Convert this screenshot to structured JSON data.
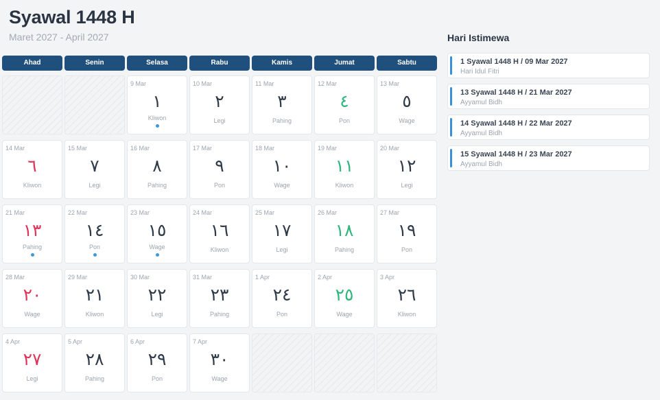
{
  "header": {
    "title": "Syawal 1448 H",
    "subtitle": "Maret 2027 - April 2027"
  },
  "weekdays": [
    "Ahad",
    "Senin",
    "Selasa",
    "Rabu",
    "Kamis",
    "Jumat",
    "Sabtu"
  ],
  "calendar": {
    "leading_empty": 2,
    "trailing_empty": 3,
    "days": [
      {
        "greg": "9 Mar",
        "hijri": "١",
        "pasaran": "Kliwon",
        "dot": true
      },
      {
        "greg": "10 Mar",
        "hijri": "٢",
        "pasaran": "Legi",
        "dot": false
      },
      {
        "greg": "11 Mar",
        "hijri": "٣",
        "pasaran": "Pahing",
        "dot": false
      },
      {
        "greg": "12 Mar",
        "hijri": "٤",
        "pasaran": "Pon",
        "dot": false
      },
      {
        "greg": "13 Mar",
        "hijri": "٥",
        "pasaran": "Wage",
        "dot": false
      },
      {
        "greg": "14 Mar",
        "hijri": "٦",
        "pasaran": "Kliwon",
        "dot": false
      },
      {
        "greg": "15 Mar",
        "hijri": "٧",
        "pasaran": "Legi",
        "dot": false
      },
      {
        "greg": "16 Mar",
        "hijri": "٨",
        "pasaran": "Pahing",
        "dot": false
      },
      {
        "greg": "17 Mar",
        "hijri": "٩",
        "pasaran": "Pon",
        "dot": false
      },
      {
        "greg": "18 Mar",
        "hijri": "١٠",
        "pasaran": "Wage",
        "dot": false
      },
      {
        "greg": "19 Mar",
        "hijri": "١١",
        "pasaran": "Kliwon",
        "dot": false
      },
      {
        "greg": "20 Mar",
        "hijri": "١٢",
        "pasaran": "Legi",
        "dot": false
      },
      {
        "greg": "21 Mar",
        "hijri": "١٣",
        "pasaran": "Pahing",
        "dot": true
      },
      {
        "greg": "22 Mar",
        "hijri": "١٤",
        "pasaran": "Pon",
        "dot": true
      },
      {
        "greg": "23 Mar",
        "hijri": "١٥",
        "pasaran": "Wage",
        "dot": true
      },
      {
        "greg": "24 Mar",
        "hijri": "١٦",
        "pasaran": "Kliwon",
        "dot": false
      },
      {
        "greg": "25 Mar",
        "hijri": "١٧",
        "pasaran": "Legi",
        "dot": false
      },
      {
        "greg": "26 Mar",
        "hijri": "١٨",
        "pasaran": "Pahing",
        "dot": false
      },
      {
        "greg": "27 Mar",
        "hijri": "١٩",
        "pasaran": "Pon",
        "dot": false
      },
      {
        "greg": "28 Mar",
        "hijri": "٢٠",
        "pasaran": "Wage",
        "dot": false
      },
      {
        "greg": "29 Mar",
        "hijri": "٢١",
        "pasaran": "Kliwon",
        "dot": false
      },
      {
        "greg": "30 Mar",
        "hijri": "٢٢",
        "pasaran": "Legi",
        "dot": false
      },
      {
        "greg": "31 Mar",
        "hijri": "٢٣",
        "pasaran": "Pahing",
        "dot": false
      },
      {
        "greg": "1 Apr",
        "hijri": "٢٤",
        "pasaran": "Pon",
        "dot": false
      },
      {
        "greg": "2 Apr",
        "hijri": "٢٥",
        "pasaran": "Wage",
        "dot": false
      },
      {
        "greg": "3 Apr",
        "hijri": "٢٦",
        "pasaran": "Kliwon",
        "dot": false
      },
      {
        "greg": "4 Apr",
        "hijri": "٢٧",
        "pasaran": "Legi",
        "dot": false
      },
      {
        "greg": "5 Apr",
        "hijri": "٢٨",
        "pasaran": "Pahing",
        "dot": false
      },
      {
        "greg": "6 Apr",
        "hijri": "٢٩",
        "pasaran": "Pon",
        "dot": false
      },
      {
        "greg": "7 Apr",
        "hijri": "٣٠",
        "pasaran": "Wage",
        "dot": false
      }
    ]
  },
  "sidebar": {
    "title": "Hari Istimewa",
    "events": [
      {
        "date": "1 Syawal 1448 H / 09 Mar 2027",
        "name": "Hari Idul Fitri"
      },
      {
        "date": "13 Syawal 1448 H / 21 Mar 2027",
        "name": "Ayyamul Bidh"
      },
      {
        "date": "14 Syawal 1448 H / 22 Mar 2027",
        "name": "Ayyamul Bidh"
      },
      {
        "date": "15 Syawal 1448 H / 23 Mar 2027",
        "name": "Ayyamul Bidh"
      }
    ]
  },
  "colors": {
    "weekday_header": "#1e4f7d",
    "sunday_number": "#e0335a",
    "friday_number": "#2fb67c",
    "event_dot": "#3b9ad9",
    "event_accent": "#3b8fd6"
  }
}
